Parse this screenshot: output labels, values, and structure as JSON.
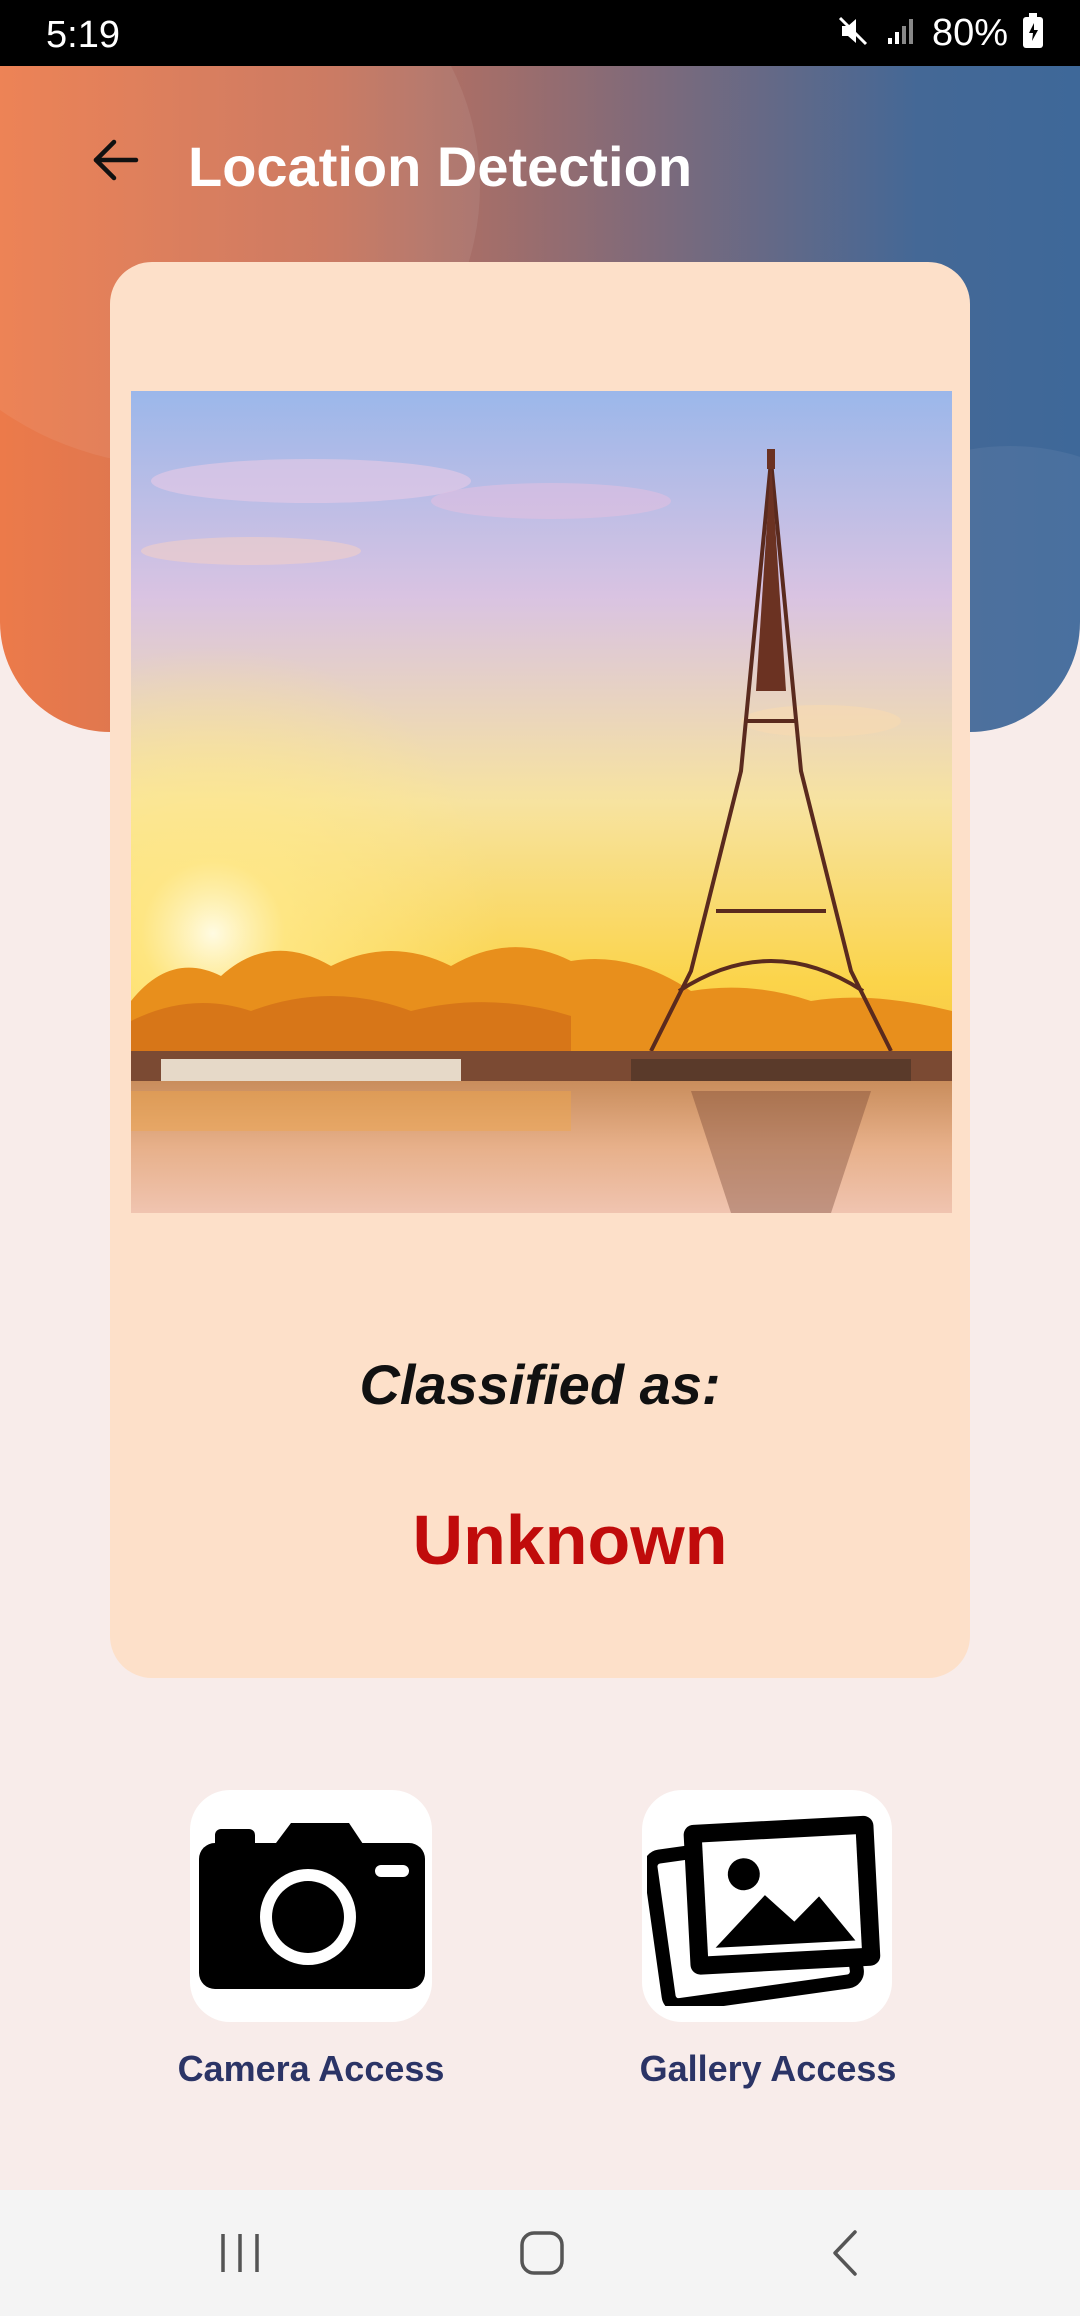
{
  "status_bar": {
    "time": "5:19",
    "battery": "80%"
  },
  "header": {
    "title": "Location Detection",
    "gradient_start": "#ec7a4a",
    "gradient_end": "#3e6899"
  },
  "card": {
    "image": "eiffel-tower-sunset-photo",
    "classified_label": "Classified as:",
    "classified_value": "Unknown",
    "value_color": "#c00b0b"
  },
  "actions": [
    {
      "label": "Camera Access",
      "icon": "camera-icon"
    },
    {
      "label": "Gallery Access",
      "icon": "gallery-icon"
    }
  ],
  "nav": {
    "recent": "recent-apps-icon",
    "home": "home-icon",
    "back": "back-icon"
  }
}
